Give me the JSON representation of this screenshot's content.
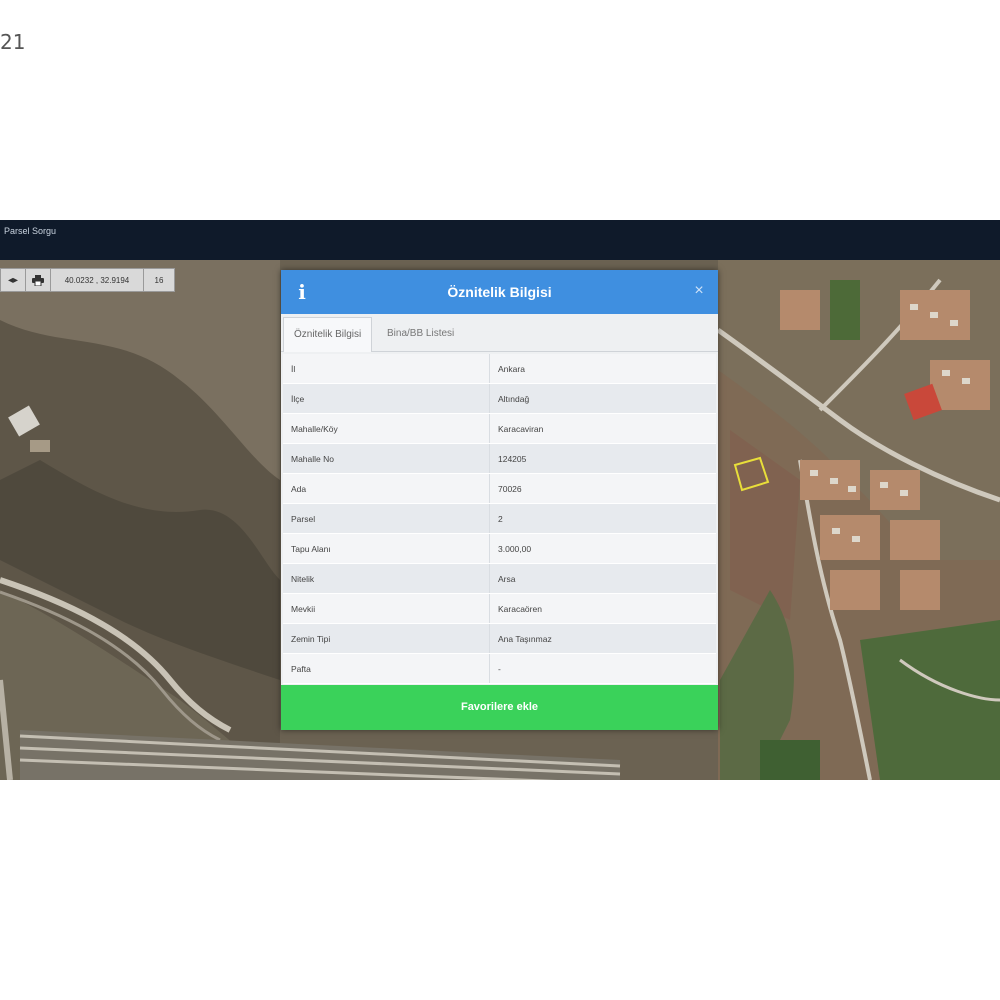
{
  "corner_number": "21",
  "app": {
    "title": "Parsel Sorgu"
  },
  "toolbar": {
    "first_icon": "arrows-icon",
    "print_icon": "print-icon",
    "coords": "40.0232 , 32.9194",
    "zoom": "16"
  },
  "dialog": {
    "title": "Öznitelik Bilgisi",
    "close_glyph": "×",
    "info_glyph": "i",
    "tabs": [
      {
        "label": "Öznitelik Bilgisi"
      },
      {
        "label": "Bina/BB Listesi"
      }
    ],
    "rows": [
      {
        "key": "İl",
        "value": "Ankara"
      },
      {
        "key": "İlçe",
        "value": "Altındağ"
      },
      {
        "key": "Mahalle/Köy",
        "value": "Karacaviran"
      },
      {
        "key": "Mahalle No",
        "value": "124205"
      },
      {
        "key": "Ada",
        "value": "70026"
      },
      {
        "key": "Parsel",
        "value": "2"
      },
      {
        "key": "Tapu Alanı",
        "value": "3.000,00"
      },
      {
        "key": "Nitelik",
        "value": "Arsa"
      },
      {
        "key": "Mevkii",
        "value": "Karacaören"
      },
      {
        "key": "Zemin Tipi",
        "value": "Ana Taşınmaz"
      },
      {
        "key": "Pafta",
        "value": "-"
      }
    ],
    "favorite_button": "Favorilere ekle"
  },
  "colors": {
    "header_blue": "#3f8fe0",
    "favorite_green": "#3ad25a",
    "topbar": "#0f1a2a"
  }
}
